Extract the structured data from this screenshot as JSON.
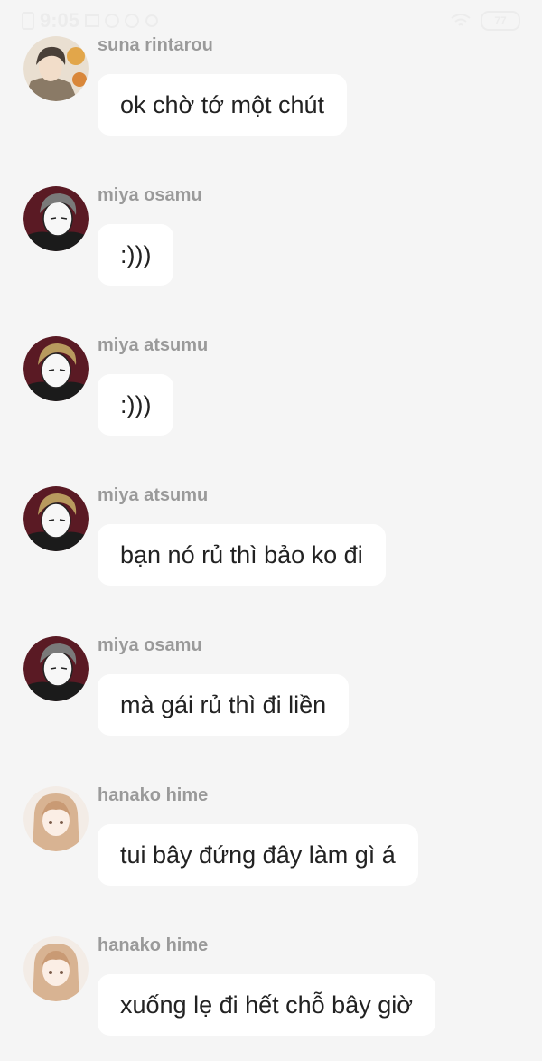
{
  "status_bar": {
    "time": "9:05",
    "battery": "77"
  },
  "messages": [
    {
      "sender": "suna rintarou",
      "text": "ok chờ tớ một chút",
      "avatar": "suna-avatar"
    },
    {
      "sender": "miya osamu",
      "text": ":)))",
      "avatar": "osamu-avatar"
    },
    {
      "sender": "miya atsumu",
      "text": ":)))",
      "avatar": "atsumu-avatar"
    },
    {
      "sender": "miya atsumu",
      "text": "bạn nó rủ thì bảo ko đi",
      "avatar": "atsumu-avatar"
    },
    {
      "sender": "miya osamu",
      "text": "mà gái rủ thì đi liền",
      "avatar": "osamu-avatar"
    },
    {
      "sender": "hanako hime",
      "text": "tui bây đứng đây làm gì á",
      "avatar": "hanako-avatar"
    },
    {
      "sender": "hanako hime",
      "text": "xuống lẹ đi hết chỗ bây giờ",
      "avatar": "hanako-avatar"
    }
  ]
}
